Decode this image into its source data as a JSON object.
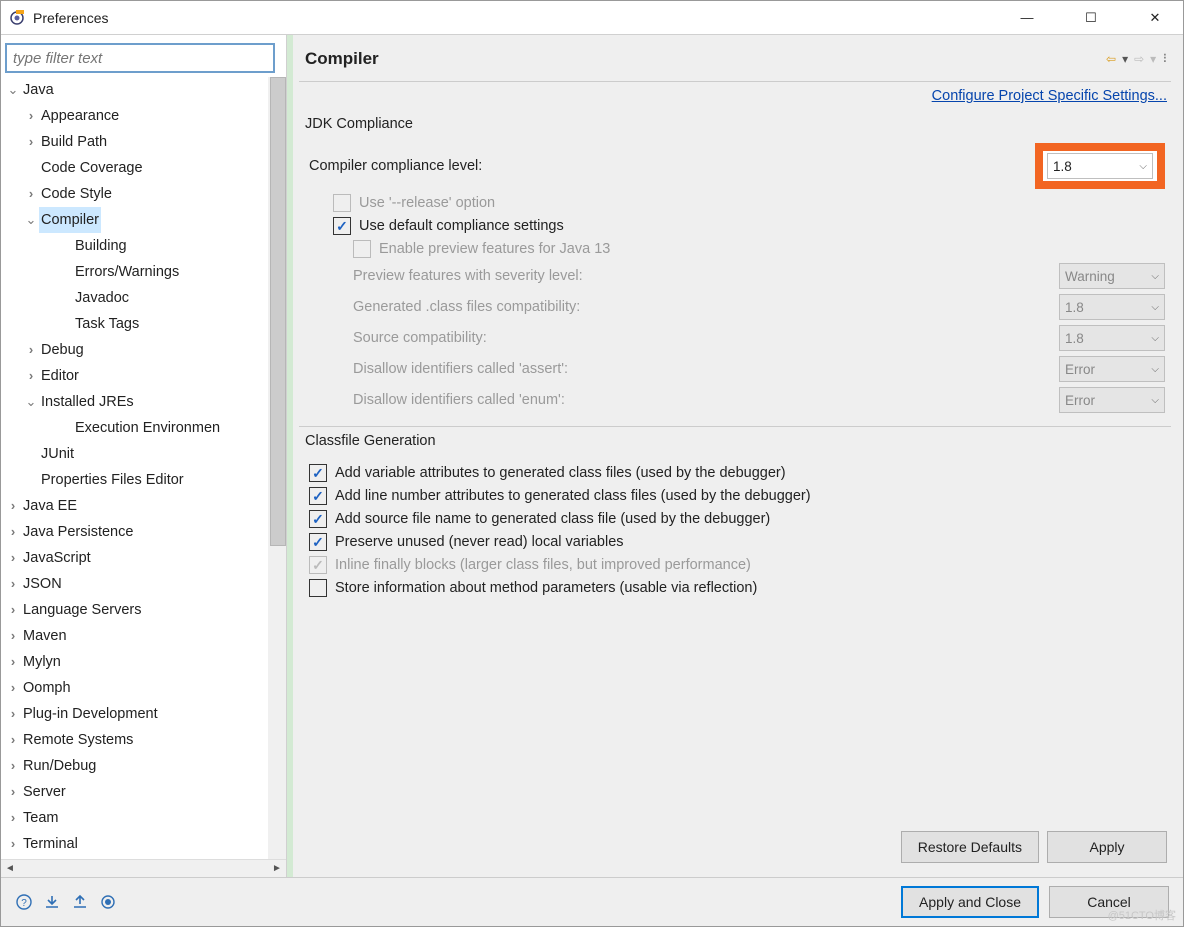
{
  "window": {
    "title": "Preferences"
  },
  "filter": {
    "placeholder": "type filter text"
  },
  "tree": [
    {
      "depth": 0,
      "twisty": "v",
      "label": "Java"
    },
    {
      "depth": 1,
      "twisty": ">",
      "label": "Appearance"
    },
    {
      "depth": 1,
      "twisty": ">",
      "label": "Build Path"
    },
    {
      "depth": 1,
      "twisty": "",
      "label": "Code Coverage"
    },
    {
      "depth": 1,
      "twisty": ">",
      "label": "Code Style"
    },
    {
      "depth": 1,
      "twisty": "v",
      "label": "Compiler",
      "selected": true
    },
    {
      "depth": 2,
      "twisty": "",
      "label": "Building"
    },
    {
      "depth": 2,
      "twisty": "",
      "label": "Errors/Warnings"
    },
    {
      "depth": 2,
      "twisty": "",
      "label": "Javadoc"
    },
    {
      "depth": 2,
      "twisty": "",
      "label": "Task Tags"
    },
    {
      "depth": 1,
      "twisty": ">",
      "label": "Debug"
    },
    {
      "depth": 1,
      "twisty": ">",
      "label": "Editor"
    },
    {
      "depth": 1,
      "twisty": "v",
      "label": "Installed JREs"
    },
    {
      "depth": 2,
      "twisty": "",
      "label": "Execution Environmen"
    },
    {
      "depth": 1,
      "twisty": "",
      "label": "JUnit"
    },
    {
      "depth": 1,
      "twisty": "",
      "label": "Properties Files Editor"
    },
    {
      "depth": 0,
      "twisty": ">",
      "label": "Java EE"
    },
    {
      "depth": 0,
      "twisty": ">",
      "label": "Java Persistence"
    },
    {
      "depth": 0,
      "twisty": ">",
      "label": "JavaScript"
    },
    {
      "depth": 0,
      "twisty": ">",
      "label": "JSON"
    },
    {
      "depth": 0,
      "twisty": ">",
      "label": "Language Servers"
    },
    {
      "depth": 0,
      "twisty": ">",
      "label": "Maven"
    },
    {
      "depth": 0,
      "twisty": ">",
      "label": "Mylyn"
    },
    {
      "depth": 0,
      "twisty": ">",
      "label": "Oomph"
    },
    {
      "depth": 0,
      "twisty": ">",
      "label": "Plug-in Development"
    },
    {
      "depth": 0,
      "twisty": ">",
      "label": "Remote Systems"
    },
    {
      "depth": 0,
      "twisty": ">",
      "label": "Run/Debug"
    },
    {
      "depth": 0,
      "twisty": ">",
      "label": "Server"
    },
    {
      "depth": 0,
      "twisty": ">",
      "label": "Team"
    },
    {
      "depth": 0,
      "twisty": ">",
      "label": "Terminal"
    }
  ],
  "main": {
    "title": "Compiler",
    "config_link": "Configure Project Specific Settings...",
    "jdk": {
      "heading": "JDK Compliance",
      "compliance_label": "Compiler compliance level:",
      "compliance_value": "1.8",
      "use_release_label": "Use '--release' option",
      "use_default_label": "Use default compliance settings",
      "enable_preview_label": "Enable preview features for Java 13",
      "preview_severity_label": "Preview features with severity level:",
      "preview_severity_value": "Warning",
      "generated_label": "Generated .class files compatibility:",
      "generated_value": "1.8",
      "source_label": "Source compatibility:",
      "source_value": "1.8",
      "assert_label": "Disallow identifiers called 'assert':",
      "assert_value": "Error",
      "enum_label": "Disallow identifiers called 'enum':",
      "enum_value": "Error"
    },
    "classfile": {
      "heading": "Classfile Generation",
      "opts": [
        {
          "checked": true,
          "disabled": false,
          "label": "Add variable attributes to generated class files (used by the debugger)"
        },
        {
          "checked": true,
          "disabled": false,
          "label": "Add line number attributes to generated class files (used by the debugger)"
        },
        {
          "checked": true,
          "disabled": false,
          "label": "Add source file name to generated class file (used by the debugger)"
        },
        {
          "checked": true,
          "disabled": false,
          "label": "Preserve unused (never read) local variables"
        },
        {
          "checked": true,
          "disabled": true,
          "label": "Inline finally blocks (larger class files, but improved performance)"
        },
        {
          "checked": false,
          "disabled": false,
          "label": "Store information about method parameters (usable via reflection)"
        }
      ]
    },
    "buttons": {
      "restore": "Restore Defaults",
      "apply": "Apply",
      "apply_close": "Apply and Close",
      "cancel": "Cancel"
    }
  },
  "watermark": "@51CTO博客"
}
